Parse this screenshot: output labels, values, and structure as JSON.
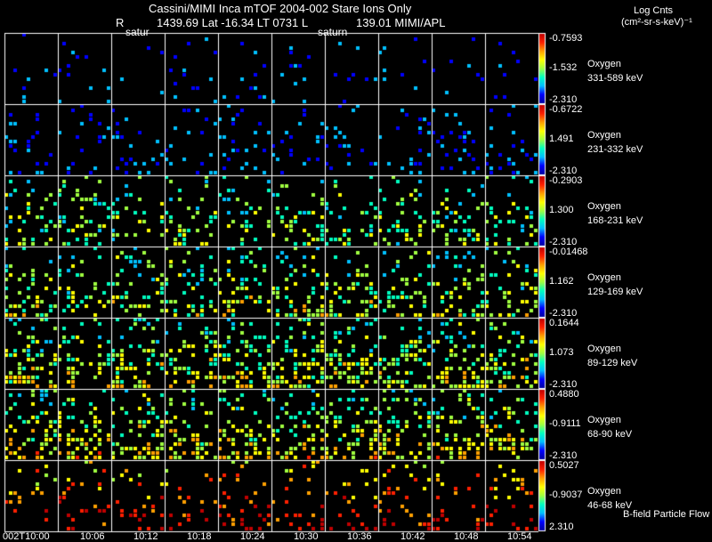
{
  "header": {
    "title": "Cassini/MIMI Inca mTOF  2004-002   Stare   Ions Only",
    "r_label": "R",
    "position": "1439.69 Lat -16.34 LT 0731 L",
    "l_value": "139.01  MIMI/APL",
    "saturn_label_1": "satur",
    "saturn_label_2": "saturn"
  },
  "colorbar_title": {
    "line1": "Log Cnts",
    "line2": "(cm²-sr-s-keV)⁻¹"
  },
  "footer_label": "B-field Particle Flow",
  "chart_data": {
    "type": "heatmap",
    "title": "Cassini/MIMI Inca mTOF  2004-002   Stare   Ions Only",
    "x_tick_labels": [
      "002T10:00",
      "10:06",
      "10:12",
      "10:18",
      "10:24",
      "10:30",
      "10:36",
      "10:42",
      "10:48",
      "10:54"
    ],
    "colormap": [
      "#0000a0",
      "#0000ff",
      "#00c0ff",
      "#00ffc0",
      "#a0ff40",
      "#ffff00",
      "#ffa000",
      "#ff2000",
      "#c00000"
    ],
    "rows": [
      {
        "species": "Oxygen",
        "energy": "331-589 keV",
        "max": "-0.7593",
        "mid": "-1.532",
        "min": "-2.310",
        "density": 0.05
      },
      {
        "species": "Oxygen",
        "energy": "231-332 keV",
        "max": "-0.6722",
        "mid": "1.491",
        "min": "-2.310",
        "density": 0.12
      },
      {
        "species": "Oxygen",
        "energy": "168-231 keV",
        "max": "-0.2903",
        "mid": "1.300",
        "min": "-2.310",
        "density": 0.2
      },
      {
        "species": "Oxygen",
        "energy": "129-169 keV",
        "max": "-0.01468",
        "mid": "1.162",
        "min": "-2.310",
        "density": 0.22
      },
      {
        "species": "Oxygen",
        "energy": "89-129 keV",
        "max": "0.1644",
        "mid": "1.073",
        "min": "-2.310",
        "density": 0.3
      },
      {
        "species": "Oxygen",
        "energy": "68-90 keV",
        "max": "0.4880",
        "mid": "-0.9111",
        "min": "-2.310",
        "density": 0.28
      },
      {
        "species": "Oxygen",
        "energy": "46-68 keV",
        "max": "0.5027",
        "mid": "-0.9037",
        "min": "2.310",
        "density": 0.12
      }
    ]
  }
}
